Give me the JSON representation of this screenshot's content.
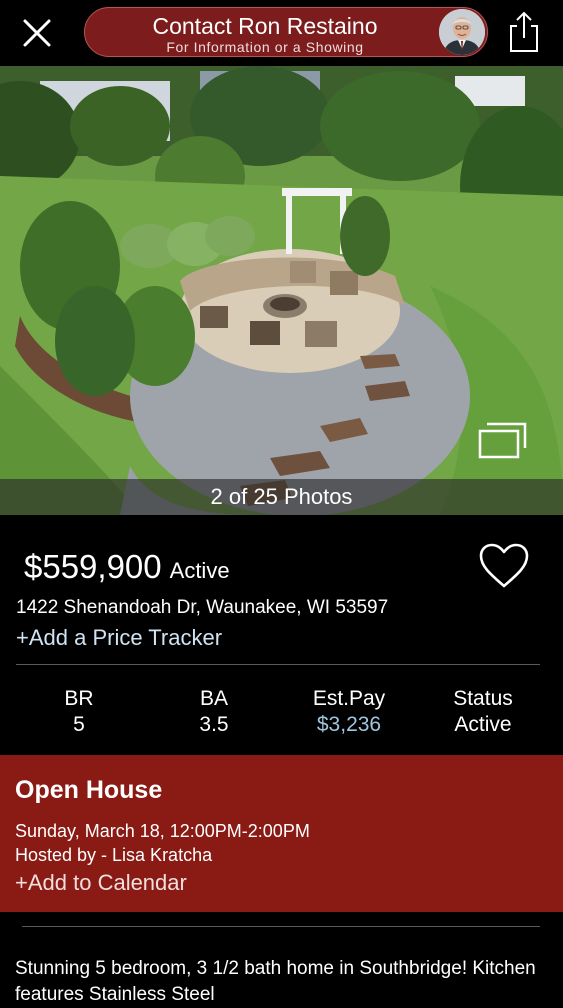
{
  "header": {
    "contact_title": "Contact Ron Restaino",
    "contact_subtitle": "For Information or a Showing",
    "close_icon": "close-icon",
    "share_icon": "share-icon",
    "avatar": "agent-avatar"
  },
  "photo": {
    "counter": "2 of 25 Photos",
    "gallery_icon": "gallery-icon"
  },
  "listing": {
    "price": "$559,900",
    "status": "Active",
    "address": "1422 Shenandoah Dr, Waunakee, WI 53597",
    "price_tracker": "+Add a Price Tracker",
    "favorite_icon": "heart-icon"
  },
  "stats": [
    {
      "label": "BR",
      "value": "5"
    },
    {
      "label": "BA",
      "value": "3.5"
    },
    {
      "label": "Est.Pay",
      "value": "$3,236"
    },
    {
      "label": "Status",
      "value": "Active"
    }
  ],
  "open_house": {
    "title": "Open House",
    "date": "Sunday, March 18, 12:00PM-2:00PM",
    "host": "Hosted by - Lisa Kratcha",
    "add_calendar": "+Add to Calendar"
  },
  "description": "Stunning 5 bedroom, 3 1/2 bath home in Southbridge!  Kitchen features Stainless Steel",
  "colors": {
    "background": "#000000",
    "accent_red": "#8a1a14",
    "pill_red": "#7d1c1c",
    "link_blue": "#9fc6e0"
  }
}
